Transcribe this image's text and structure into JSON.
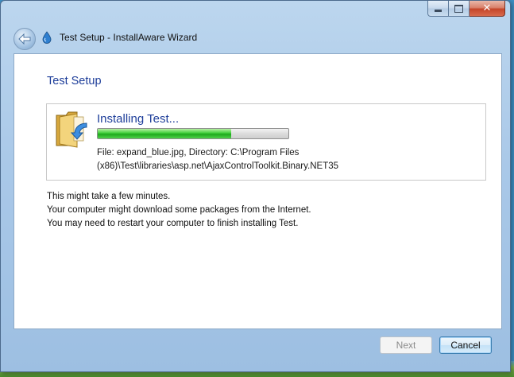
{
  "window": {
    "title": "Test Setup - InstallAware Wizard",
    "close_glyph": "✕"
  },
  "page": {
    "heading": "Test Setup",
    "status": {
      "title": "Installing Test...",
      "progress_fraction": 0.7,
      "file_line1": "File: expand_blue.jpg,  Directory: C:\\Program Files",
      "file_line2": "(x86)\\Test\\libraries\\asp.net\\AjaxControlToolkit.Binary.NET35"
    },
    "messages": [
      "This might take a few minutes.",
      "Your computer might download some packages from the Internet.",
      "You may need to restart your computer to finish installing Test."
    ]
  },
  "buttons": {
    "next": "Next",
    "cancel": "Cancel"
  },
  "colors": {
    "heading": "#1e3e9a",
    "progress": "#3fcf3a"
  },
  "icons": [
    "back-arrow-icon",
    "installer-app-icon",
    "folder-install-icon",
    "minimize-icon",
    "maximize-icon",
    "close-icon"
  ]
}
